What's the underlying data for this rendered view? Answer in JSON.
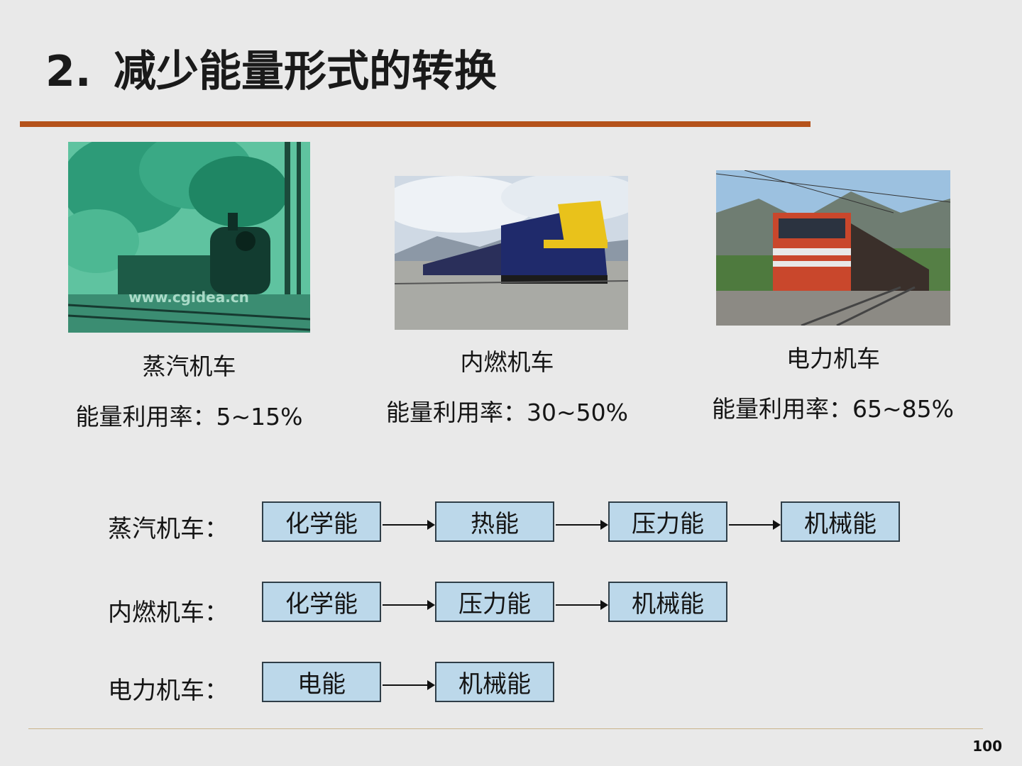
{
  "slide": {
    "title_number": "2.",
    "title_text": "减少能量形式的转换",
    "page_number": "100"
  },
  "locomotives": [
    {
      "name": "蒸汽机车",
      "efficiency": "能量利用率：5~15%",
      "photo_watermark": "www.cgidea.cn"
    },
    {
      "name": "内燃机车",
      "efficiency": "能量利用率：30~50%"
    },
    {
      "name": "电力机车",
      "efficiency": "能量利用率：65~85%"
    }
  ],
  "flows": [
    {
      "label": "蒸汽机车：",
      "steps": [
        "化学能",
        "热能",
        "压力能",
        "机械能"
      ]
    },
    {
      "label": "内燃机车：",
      "steps": [
        "化学能",
        "压力能",
        "机械能"
      ]
    },
    {
      "label": "电力机车：",
      "steps": [
        "电能",
        "机械能"
      ]
    }
  ],
  "colors": {
    "title_rule": "#b5521a",
    "box_fill": "#bcd8ea",
    "box_border": "#2f3e48",
    "background": "#e9e9e9"
  }
}
